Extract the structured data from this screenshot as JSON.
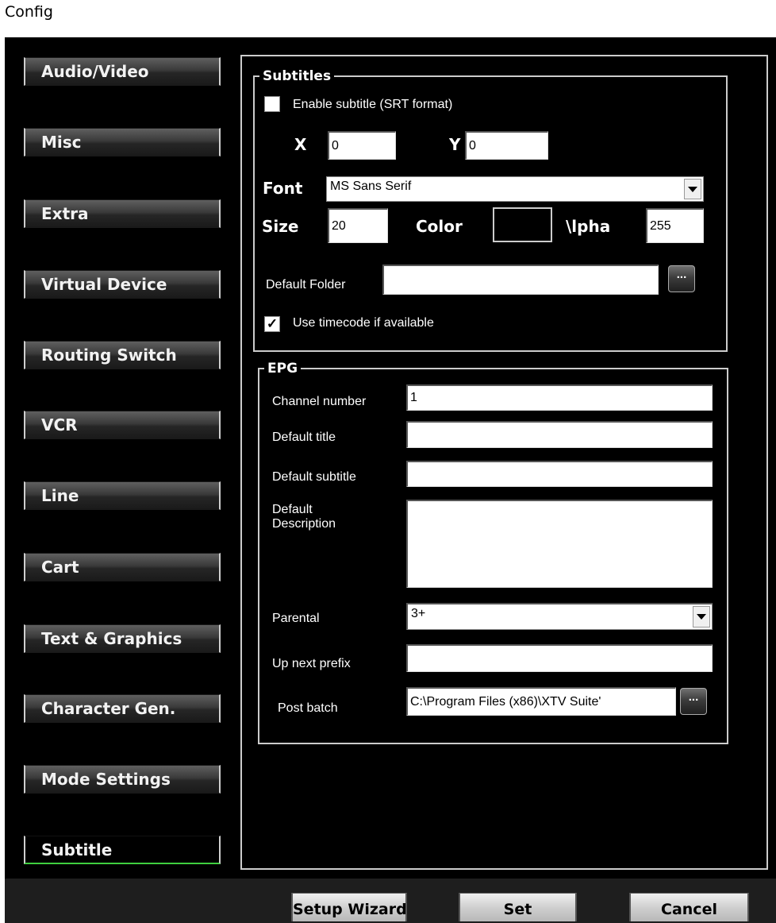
{
  "window": {
    "title": "Config"
  },
  "nav": [
    {
      "label": "Audio/Video"
    },
    {
      "label": "Misc"
    },
    {
      "label": "Extra"
    },
    {
      "label": "Virtual Device"
    },
    {
      "label": "Routing Switch"
    },
    {
      "label": "VCR"
    },
    {
      "label": "Line"
    },
    {
      "label": "Cart"
    },
    {
      "label": "Text & Graphics"
    },
    {
      "label": "Character Gen."
    },
    {
      "label": "Mode Settings"
    },
    {
      "label": "Subtitle",
      "active": true
    }
  ],
  "subtitles": {
    "legend": "Subtitles",
    "enable_label": "Enable subtitle (SRT format)",
    "enable_checked": false,
    "x_label": "X",
    "x_value": "0",
    "y_label": "Y",
    "y_value": "0",
    "font_label": "Font",
    "font_value": "MS Sans Serif",
    "size_label": "Size",
    "size_value": "20",
    "color_label": "Color",
    "color_value": "#000000",
    "alpha_label": "\\lpha",
    "alpha_value": "255",
    "folder_label": "Default Folder",
    "folder_value": "",
    "browse_label": "...",
    "timecode_label": "Use timecode if available",
    "timecode_checked": true
  },
  "epg": {
    "legend": "EPG",
    "channel_label": "Channel number",
    "channel_value": "1",
    "title_label": "Default title",
    "title_value": "",
    "subtitle_label": "Default subtitle",
    "subtitle_value": "",
    "desc_label_1": "Default",
    "desc_label_2": "Description",
    "desc_value": "",
    "parental_label": "Parental",
    "parental_value": "3+",
    "upnext_label": "Up next prefix",
    "upnext_value": "",
    "postbatch_label": "Post batch",
    "postbatch_value": "C:\\Program Files (x86)\\XTV Suite'",
    "browse_label": "..."
  },
  "footer": {
    "setup_wizard": "Setup Wizard",
    "set": "Set",
    "cancel": "Cancel"
  }
}
